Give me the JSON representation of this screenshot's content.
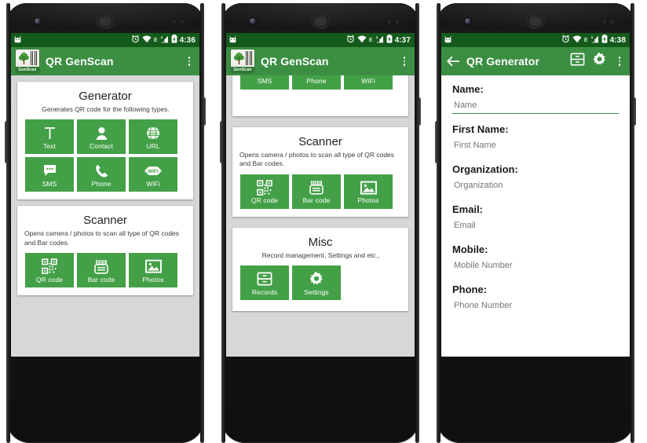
{
  "meta": {
    "accent_green": "#43a047",
    "appbar_green": "#3c8f42",
    "statusbar_green": "#145a1b",
    "page_bg": "#d6d7d9",
    "card_bg": "#ffffff"
  },
  "phones": [
    {
      "id": "phone-home",
      "status_bar": {
        "time": "4:36",
        "network_type": "E",
        "icons": [
          "android-robot-icon",
          "alarm-icon",
          "wifi-icon",
          "signal-icon",
          "battery-charging-icon"
        ]
      },
      "app_bar": {
        "logo_label": "GenScan",
        "title": "QR GenScan",
        "overflow": "overflow-menu-icon"
      },
      "cards": [
        {
          "title": "Generator",
          "subtitle": "Generates QR code for the following types.",
          "subtitle_align": "center",
          "tiles": [
            {
              "label": "Text",
              "icon": "text-icon"
            },
            {
              "label": "Contact",
              "icon": "contact-icon"
            },
            {
              "label": "URL",
              "icon": "url-globe-icon"
            },
            {
              "label": "SMS",
              "icon": "sms-bubble-icon"
            },
            {
              "label": "Phone",
              "icon": "phone-handset-icon"
            },
            {
              "label": "WiFi",
              "icon": "wifi-badge-icon"
            }
          ]
        },
        {
          "title": "Scanner",
          "subtitle": "Opens camera / photos to scan all type of QR codes and Bar codes.",
          "subtitle_align": "left",
          "tiles": [
            {
              "label": "QR code",
              "icon": "qr-code-icon"
            },
            {
              "label": "Bar code",
              "icon": "bar-code-icon"
            },
            {
              "label": "Photos",
              "icon": "photo-icon"
            }
          ]
        }
      ],
      "nav_bar": [
        "back-nav-icon",
        "home-nav-icon",
        "recents-nav-icon"
      ]
    },
    {
      "id": "phone-home-scrolled",
      "status_bar": {
        "time": "4:37",
        "network_type": "E",
        "icons": [
          "android-robot-icon",
          "alarm-icon",
          "wifi-icon",
          "signal-icon",
          "battery-charging-icon"
        ]
      },
      "app_bar": {
        "logo_label": "GenScan",
        "title": "QR GenScan",
        "overflow": "overflow-menu-icon"
      },
      "clipped_tiles": [
        {
          "label": "SMS",
          "icon": "sms-bubble-icon"
        },
        {
          "label": "Phone",
          "icon": "phone-handset-icon"
        },
        {
          "label": "WiFi",
          "icon": "wifi-badge-icon"
        }
      ],
      "cards": [
        {
          "title": "Scanner",
          "subtitle": "Opens camera / photos to scan all type of QR codes and Bar codes.",
          "subtitle_align": "left",
          "tiles": [
            {
              "label": "QR code",
              "icon": "qr-code-icon"
            },
            {
              "label": "Bar code",
              "icon": "bar-code-icon"
            },
            {
              "label": "Photos",
              "icon": "photo-icon"
            }
          ]
        },
        {
          "title": "Misc",
          "subtitle": "Record management, Settings and etc.,",
          "subtitle_align": "center",
          "tiles": [
            {
              "label": "Records",
              "icon": "records-drawer-icon"
            },
            {
              "label": "Settings",
              "icon": "gear-icon"
            }
          ]
        }
      ],
      "nav_bar": [
        "back-nav-icon",
        "home-nav-icon",
        "recents-nav-icon"
      ]
    },
    {
      "id": "phone-generator-form",
      "status_bar": {
        "time": "4:38",
        "network_type": "E",
        "icons": [
          "android-robot-icon",
          "alarm-icon",
          "wifi-icon",
          "signal-icon",
          "battery-charging-icon"
        ]
      },
      "app_bar": {
        "back": "back-arrow-icon",
        "title": "QR Generator",
        "actions": [
          "records-drawer-icon",
          "gear-icon",
          "overflow-menu-icon"
        ]
      },
      "form_fields": [
        {
          "label": "Name:",
          "placeholder": "Name",
          "focused": true
        },
        {
          "label": "First Name:",
          "placeholder": "First Name",
          "focused": false
        },
        {
          "label": "Organization:",
          "placeholder": "Organization",
          "focused": false
        },
        {
          "label": "Email:",
          "placeholder": "Email",
          "focused": false
        },
        {
          "label": "Mobile:",
          "placeholder": "Mobile Number",
          "focused": false
        },
        {
          "label": "Phone:",
          "placeholder": "Phone Number",
          "focused": false
        }
      ],
      "nav_bar": [
        "back-nav-icon",
        "home-nav-icon",
        "recents-nav-icon"
      ]
    }
  ]
}
